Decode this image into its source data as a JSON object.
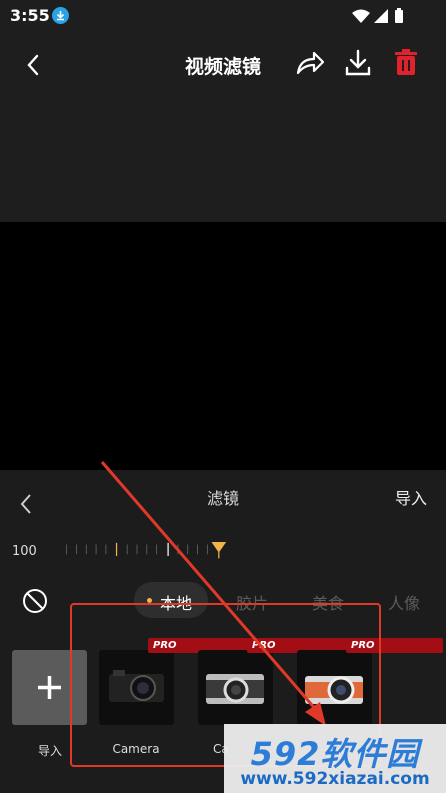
{
  "status_bar": {
    "time": "3:55",
    "download_icon": "download-icon",
    "wifi_icon": "wifi-icon",
    "signal_icon": "signal-icon",
    "battery_icon": "battery-icon"
  },
  "toolbar": {
    "title": "视频滤镜",
    "back_icon": "chevron-left-icon",
    "share_icon": "share-icon",
    "download_icon": "download-icon",
    "delete_icon": "trash-icon",
    "delete_color": "#e0222c"
  },
  "filter_panel": {
    "title": "滤镜",
    "import_label": "导入",
    "intensity_value": "100",
    "accent_color": "#f3b34a",
    "tabs": [
      {
        "label": "本地",
        "active": true
      },
      {
        "label": "胶片",
        "active": false
      },
      {
        "label": "美食",
        "active": false
      },
      {
        "label": "人像",
        "active": false
      }
    ],
    "items": [
      {
        "label": "导入",
        "type": "add",
        "pro": false
      },
      {
        "label": "Camera",
        "type": "camera-dark",
        "pro": true
      },
      {
        "label": "Ca",
        "type": "camera-silver",
        "pro": true
      },
      {
        "label": "",
        "type": "camera-orange",
        "pro": true
      }
    ],
    "pro_badge": "PRO"
  },
  "watermark": {
    "brand": "592软件园",
    "url": "www.592xiazai.com"
  }
}
